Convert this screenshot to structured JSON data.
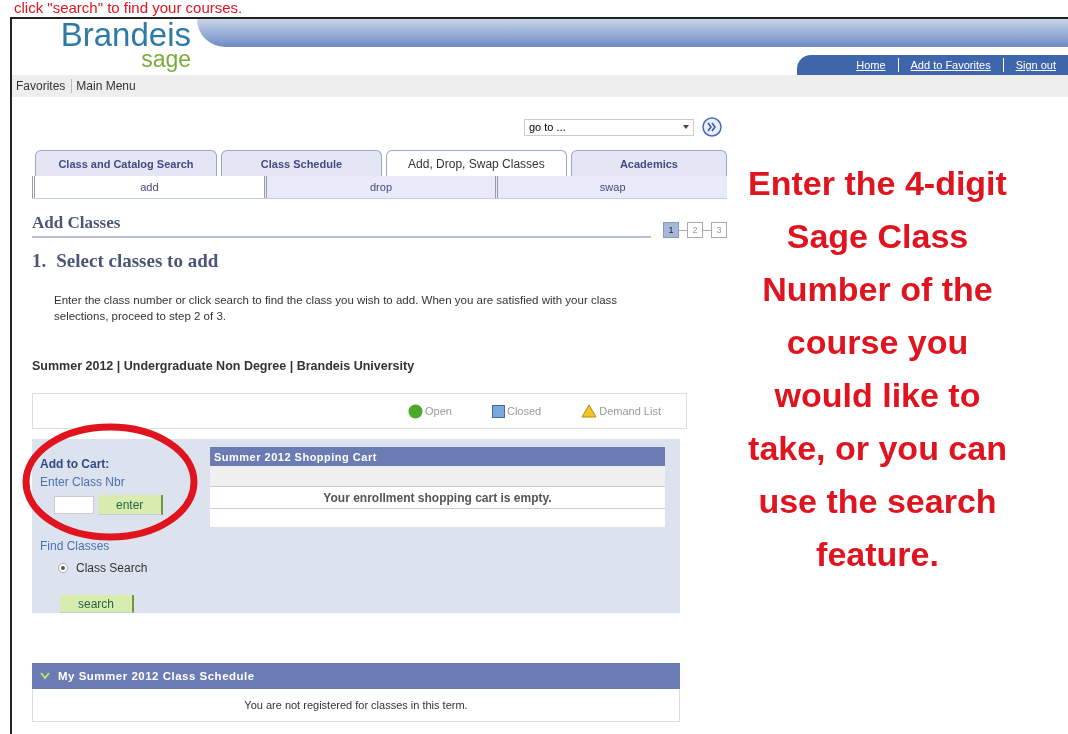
{
  "caption": "click \"search\" to find your courses.",
  "header": {
    "logo_title": "Brandeis",
    "logo_subtitle": "sage",
    "links": [
      "Home",
      "Add to Favorites",
      "Sign out"
    ]
  },
  "menu": [
    "Favorites",
    "Main Menu"
  ],
  "goto": {
    "value": "go to ..."
  },
  "tabs": [
    {
      "label": "Class and Catalog Search",
      "selected": false
    },
    {
      "label": "Class Schedule",
      "selected": false
    },
    {
      "label": "Add, Drop, Swap Classes",
      "selected": true
    },
    {
      "label": "Academics",
      "selected": false
    }
  ],
  "subtabs": [
    {
      "label": "add",
      "selected": true
    },
    {
      "label": "drop",
      "selected": false
    },
    {
      "label": "swap",
      "selected": false
    }
  ],
  "page_title": "Add Classes",
  "steps": [
    {
      "label": "1",
      "selected": true
    },
    {
      "label": "2",
      "selected": false
    },
    {
      "label": "3",
      "selected": false
    }
  ],
  "step_number": "1.",
  "step_heading": "Select classes to add",
  "instructions": "Enter the class number or click search to find the class you wish to add. When you are satisfied with your class selections, proceed to step 2 of 3.",
  "term": "Summer 2012 | Undergraduate Non Degree | Brandeis University",
  "legend": [
    {
      "kind": "open",
      "label": "Open"
    },
    {
      "kind": "closed",
      "label": "Closed"
    },
    {
      "kind": "demand",
      "label": "Demand List"
    }
  ],
  "add_to_cart": {
    "title": "Add to Cart:",
    "field_label": "Enter Class Nbr",
    "button": "enter",
    "find_label": "Find Classes",
    "options": [
      {
        "label": "Class Search",
        "selected": true
      }
    ],
    "search_button": "search"
  },
  "cart": {
    "title": "Summer 2012 Shopping Cart",
    "empty_message": "Your enrollment shopping cart is empty."
  },
  "schedule": {
    "title": "My Summer 2012 Class Schedule",
    "expanded": true,
    "message": "You are not registered for classes in this term."
  },
  "annotation": {
    "lines": [
      "Enter the 4-digit",
      "Sage Class",
      "Number of the",
      "course you",
      "would like to",
      "take, or you can",
      "use the search",
      "feature."
    ]
  }
}
